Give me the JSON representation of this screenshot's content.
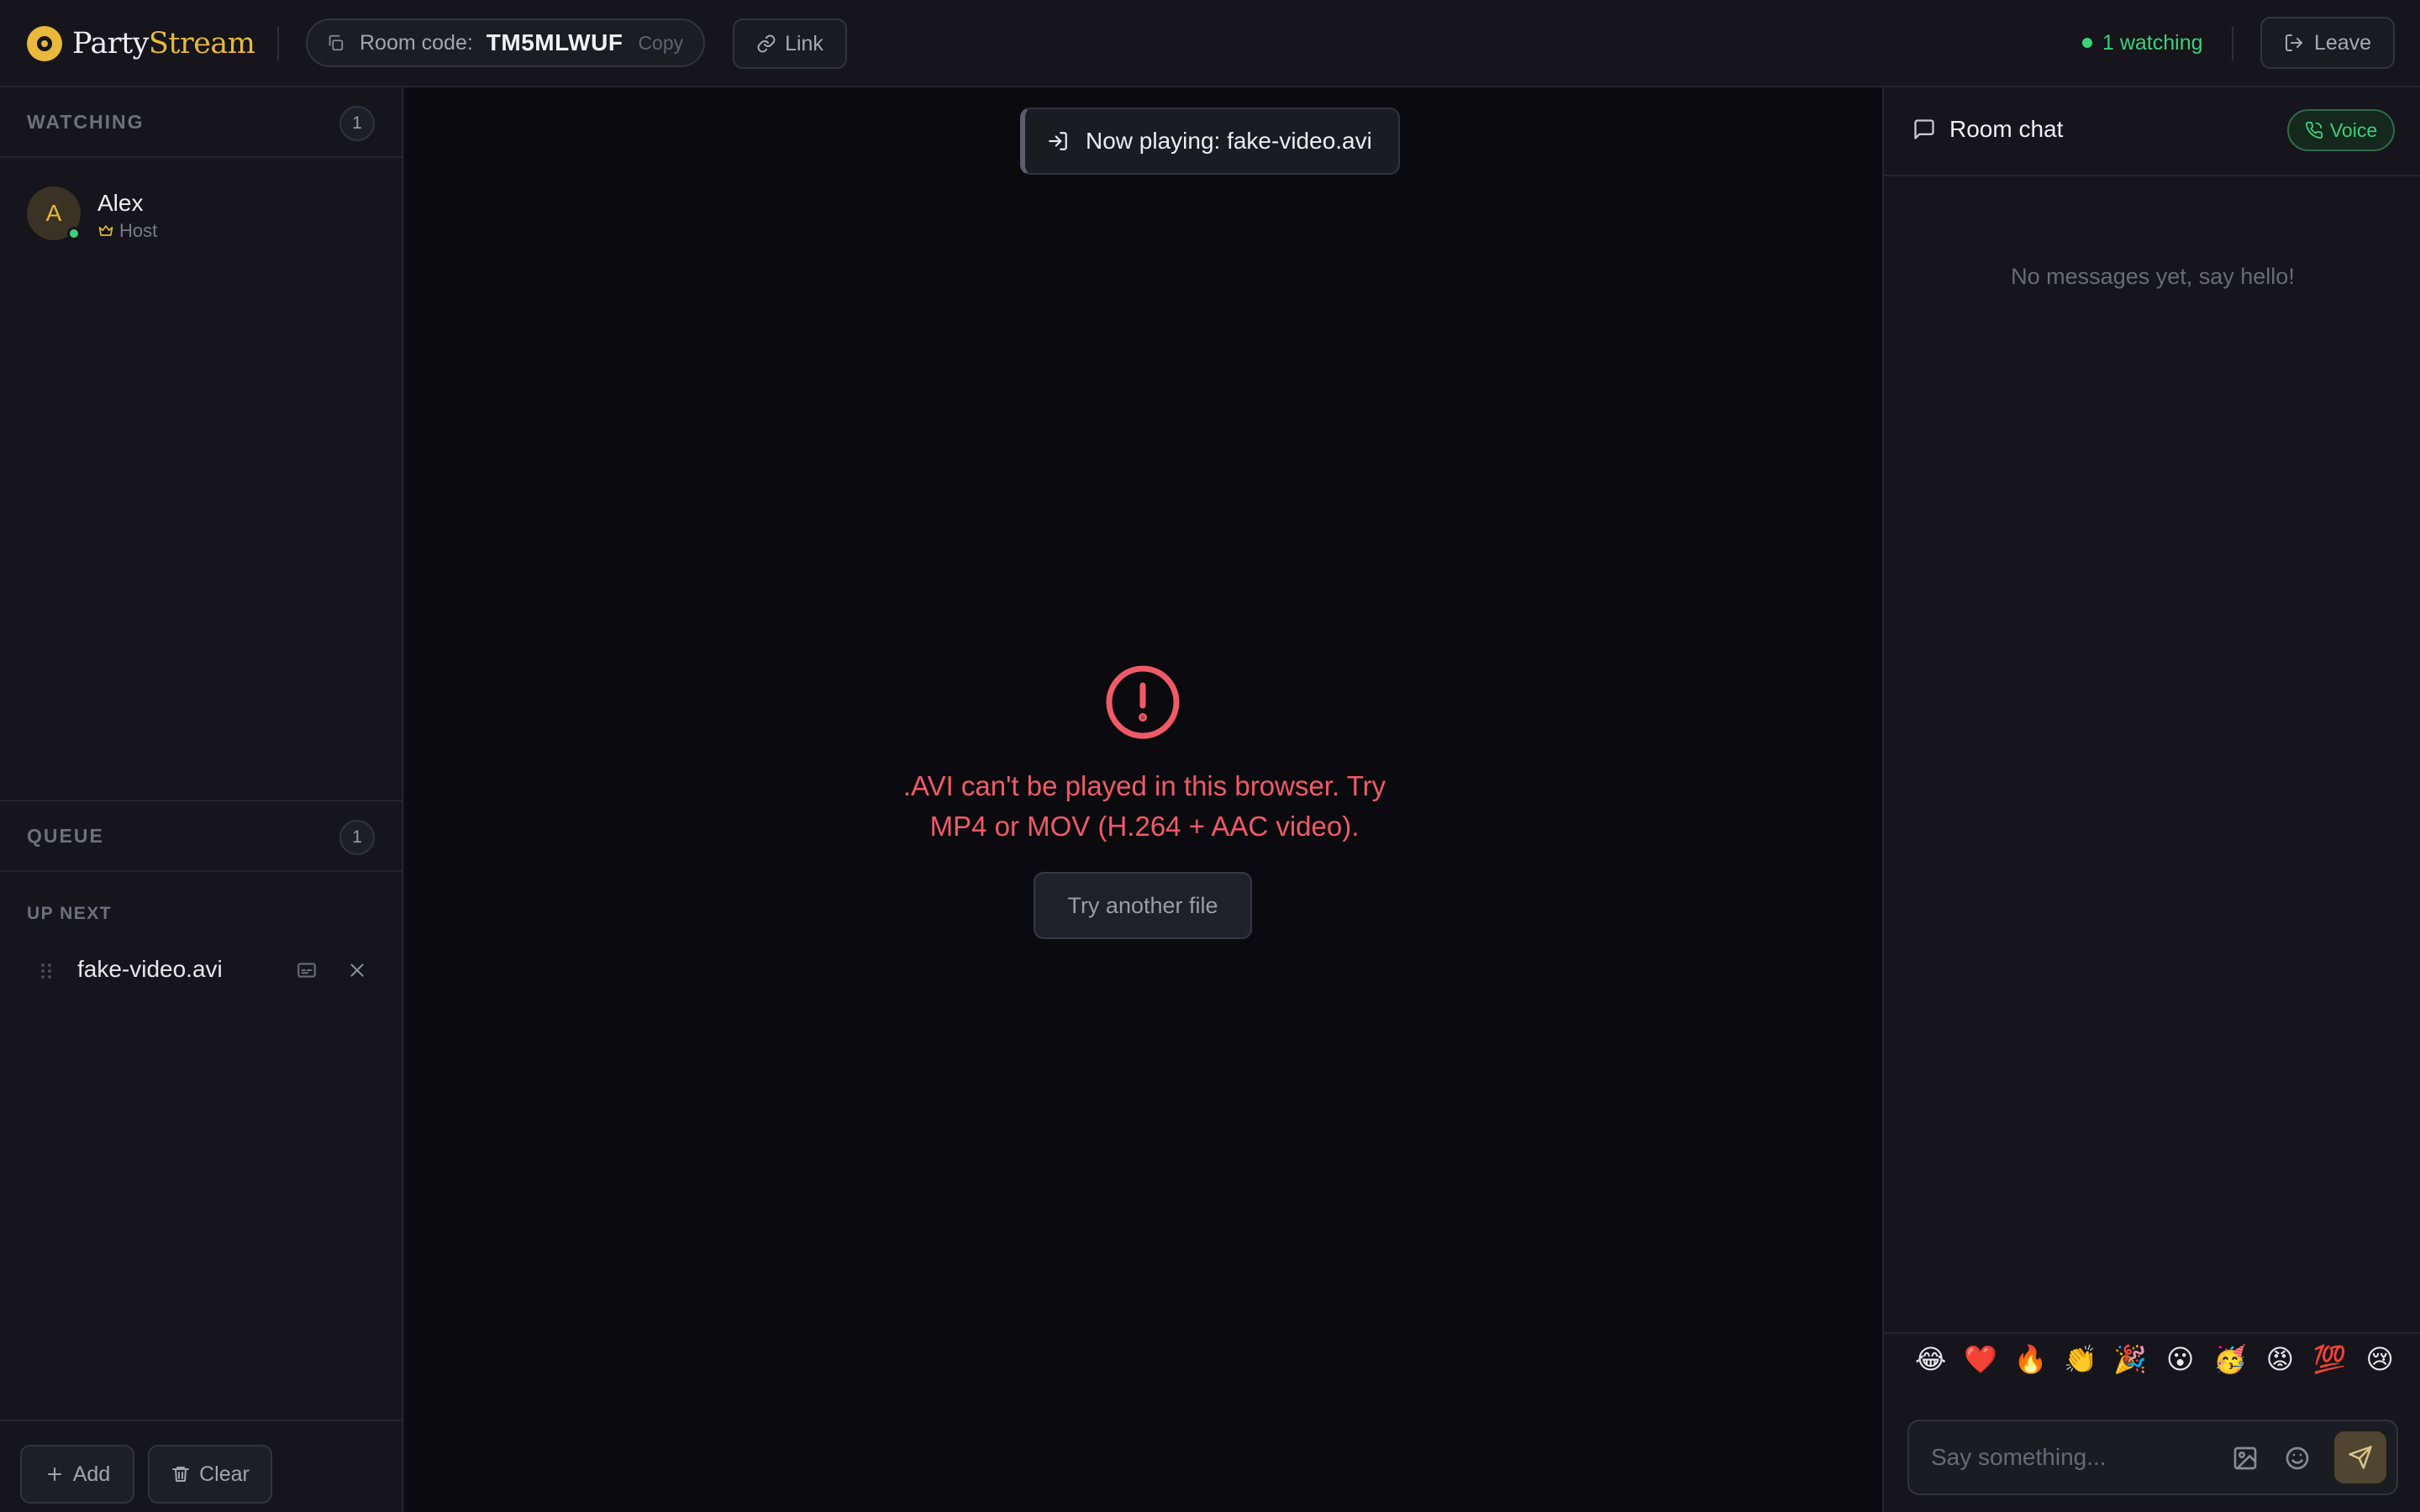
{
  "app": {
    "name_part1": "Party",
    "name_part2": "Stream"
  },
  "header": {
    "room_label": "Room code:",
    "room_code": "TM5MLWUF",
    "copy_label": "Copy",
    "link_label": "Link",
    "watching_label": "1 watching",
    "leave_label": "Leave"
  },
  "sidebar": {
    "watching_title": "WATCHING",
    "watching_count": "1",
    "members": [
      {
        "initial": "A",
        "name": "Alex",
        "role": "Host"
      }
    ],
    "queue_title": "QUEUE",
    "queue_count": "1",
    "up_next_label": "UP NEXT",
    "queue_items": [
      {
        "name": "fake-video.avi"
      }
    ],
    "add_label": "Add",
    "clear_label": "Clear"
  },
  "stage": {
    "toast_text": "Now playing: fake-video.avi",
    "error_message": ".AVI can't be played in this browser. Try MP4 or MOV (H.264 + AAC video).",
    "retry_label": "Try another file"
  },
  "chat": {
    "title": "Room chat",
    "voice_label": "Voice",
    "empty_text": "No messages yet, say hello!",
    "emojis": [
      "😂",
      "❤️",
      "🔥",
      "👏",
      "🎉",
      "😮",
      "🥳",
      "😡",
      "💯",
      "😢"
    ],
    "input_placeholder": "Say something..."
  },
  "colors": {
    "accent": "#e8b93a",
    "online": "#3ecf7a",
    "error": "#f05a67",
    "background": "#0b0b0f",
    "panel": "#15151b"
  },
  "icons": {
    "logo": "partystream-logo-icon",
    "copy": "copy-icon",
    "link": "link-icon",
    "leave": "logout-icon",
    "host": "crown-icon",
    "drag": "drag-handle-icon",
    "subtitles": "subtitles-icon",
    "remove": "close-icon",
    "add": "plus-icon",
    "clear": "trash-icon",
    "now_playing": "enter-icon",
    "error": "alert-circle-icon",
    "chat": "message-square-icon",
    "voice": "phone-icon",
    "image": "image-icon",
    "emoji": "smile-icon",
    "send": "send-icon"
  }
}
